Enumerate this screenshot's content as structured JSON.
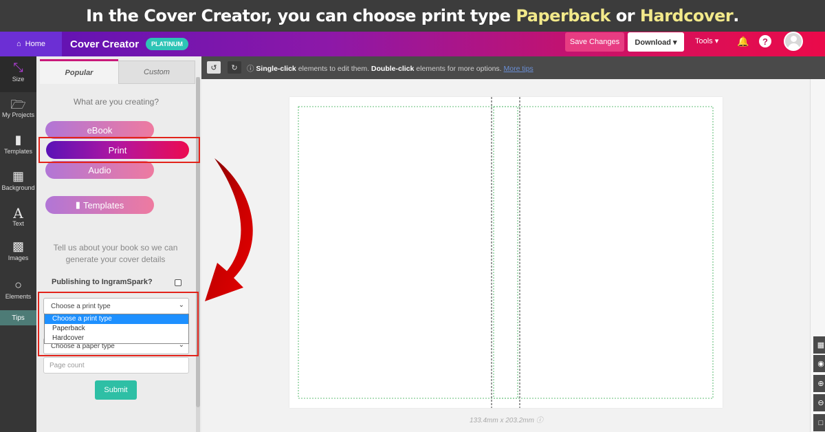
{
  "banner": {
    "prefix": "In the Cover Creator, you can choose print type ",
    "hl1": "Paperback",
    "mid": " or ",
    "hl2": "Hardcover",
    "suffix": "."
  },
  "topbar": {
    "home": "Home",
    "brand": "Cover Creator",
    "plan_badge": "PLATINUM",
    "save": "Save Changes",
    "download": "Download ▾",
    "tools": "Tools ▾",
    "accent_gradient": [
      "#5b12b5",
      "#ea0a4a"
    ]
  },
  "leftnav": {
    "items": [
      {
        "label": "Size",
        "icon": "resize-arrow-icon"
      },
      {
        "label": "My Projects",
        "icon": "folder-icon"
      },
      {
        "label": "Templates",
        "icon": "bookmark-icon"
      },
      {
        "label": "Background",
        "icon": "background-image-icon"
      },
      {
        "label": "Text",
        "icon": "text-icon"
      },
      {
        "label": "Images",
        "icon": "image-icon"
      },
      {
        "label": "Elements",
        "icon": "circle-icon"
      }
    ],
    "tips": "Tips"
  },
  "panel": {
    "tabs": [
      "Popular",
      "Custom"
    ],
    "question": "What are you creating?",
    "options": [
      "eBook",
      "Print",
      "Audio",
      "Templates"
    ],
    "info_line1": "Tell us about your book so we can",
    "info_line2": "generate your cover details",
    "ingram_label": "Publishing to IngramSpark?",
    "print_type_value": "Choose a print type",
    "print_type_options": [
      "Choose a print type",
      "Paperback",
      "Hardcover"
    ],
    "paper_type_value": "Choose a paper type",
    "page_count_placeholder": "Page count",
    "submit": "Submit"
  },
  "toolbar": {
    "msg_b1": "Single-click",
    "msg_t1": " elements to edit them. ",
    "msg_b2": "Double-click",
    "msg_t2": " elements for more options. ",
    "more_tips": "More tips"
  },
  "canvas": {
    "dimensions": "133.4mm x 203.2mm"
  }
}
